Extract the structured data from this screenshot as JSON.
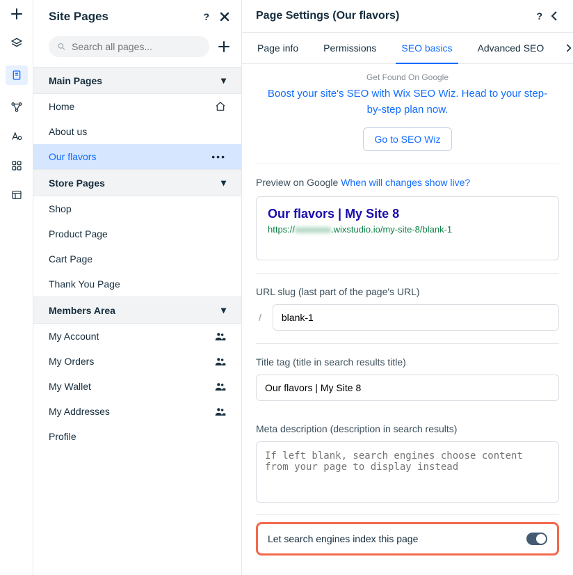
{
  "left_panel": {
    "title": "Site Pages",
    "search_placeholder": "Search all pages...",
    "sections": {
      "main": {
        "label": "Main Pages",
        "items": [
          "Home",
          "About us",
          "Our flavors"
        ]
      },
      "store": {
        "label": "Store Pages",
        "items": [
          "Shop",
          "Product Page",
          "Cart Page",
          "Thank You Page"
        ]
      },
      "members": {
        "label": "Members Area",
        "items": [
          "My Account",
          "My Orders",
          "My Wallet",
          "My Addresses",
          "Profile"
        ]
      }
    }
  },
  "settings": {
    "title": "Page Settings (Our flavors)",
    "tabs": [
      "Page info",
      "Permissions",
      "SEO basics",
      "Advanced SEO"
    ],
    "active_tab_index": 2,
    "promo": {
      "kicker": "Get Found On Google",
      "text": "Boost your site's SEO with Wix SEO Wiz. Head to your step-by-step plan now.",
      "cta": "Go to SEO Wiz"
    },
    "preview": {
      "label": "Preview on Google",
      "live_link": "When will changes show live?",
      "title": "Our flavors | My Site 8",
      "url_prefix": "https://",
      "url_hidden": "xxxxxxxx",
      "url_rest": ".wixstudio.io/my-site-8/blank-1"
    },
    "slug": {
      "label": "URL slug (last part of the page's URL)",
      "value": "blank-1"
    },
    "title_tag": {
      "label": "Title tag (title in search results title)",
      "value": "Our flavors | My Site 8"
    },
    "meta": {
      "label": "Meta description (description in search results)",
      "placeholder": "If left blank, search engines choose content from your page to display instead"
    },
    "index_toggle": {
      "label": "Let search engines index this page",
      "on": true
    }
  }
}
